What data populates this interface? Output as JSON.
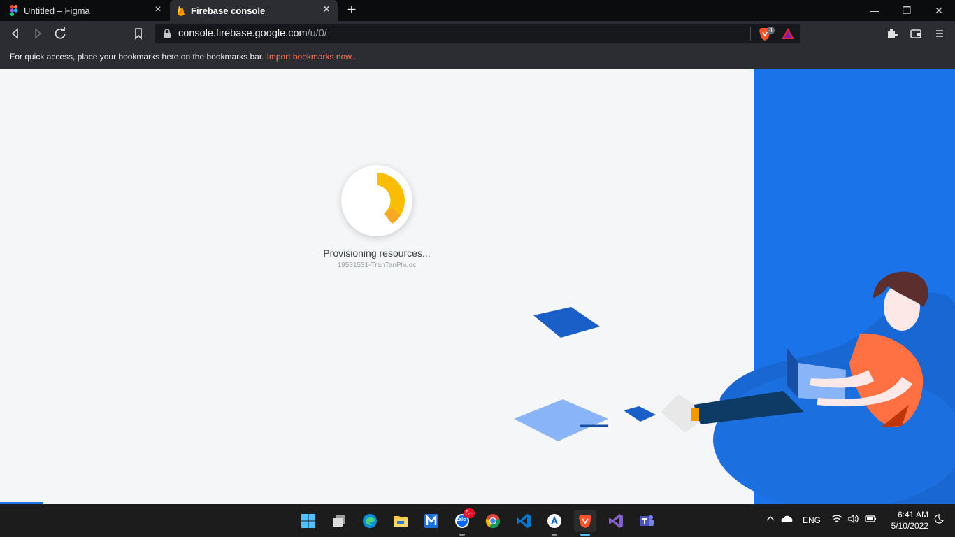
{
  "browser": {
    "tabs": [
      {
        "title": "Untitled – Figma",
        "icon": "figma-icon",
        "active": false
      },
      {
        "title": "Firebase console",
        "icon": "firebase-icon",
        "active": true
      }
    ],
    "new_tab_glyph": "+",
    "window_controls": {
      "minimize": "—",
      "restore": "❐",
      "close": "✕"
    },
    "url": {
      "host": "console.firebase.google.com",
      "path": "/u/0/"
    },
    "shields_count": "4",
    "bookmarks_bar": {
      "text": "For quick access, place your bookmarks here on the bookmarks bar.",
      "link": "Import bookmarks now..."
    }
  },
  "page": {
    "status": "Provisioning resources...",
    "project_id": "19531531-TranTanPhuoc",
    "accent_blue": "#1a73e8",
    "spinner_color": "#fbbc04"
  },
  "taskbar": {
    "apps": [
      {
        "name": "start-button",
        "icon": "windows-icon"
      },
      {
        "name": "task-view-button",
        "icon": "task-view-icon"
      },
      {
        "name": "edge-button",
        "icon": "edge-icon"
      },
      {
        "name": "file-explorer-button",
        "icon": "folder-icon"
      },
      {
        "name": "m-app-button",
        "icon": "m-app-icon"
      },
      {
        "name": "zalo-button",
        "icon": "zalo-icon",
        "badge": "5+",
        "label": "Zalo"
      },
      {
        "name": "chrome-button",
        "icon": "chrome-icon"
      },
      {
        "name": "vscode-button",
        "icon": "vscode-icon"
      },
      {
        "name": "a-app-button",
        "icon": "a-app-icon"
      },
      {
        "name": "brave-button",
        "icon": "brave-icon"
      },
      {
        "name": "visual-studio-button",
        "icon": "visual-studio-icon"
      },
      {
        "name": "teams-button",
        "icon": "teams-icon"
      }
    ],
    "tray": {
      "language": "ENG",
      "time": "6:41 AM",
      "date": "5/10/2022"
    }
  }
}
